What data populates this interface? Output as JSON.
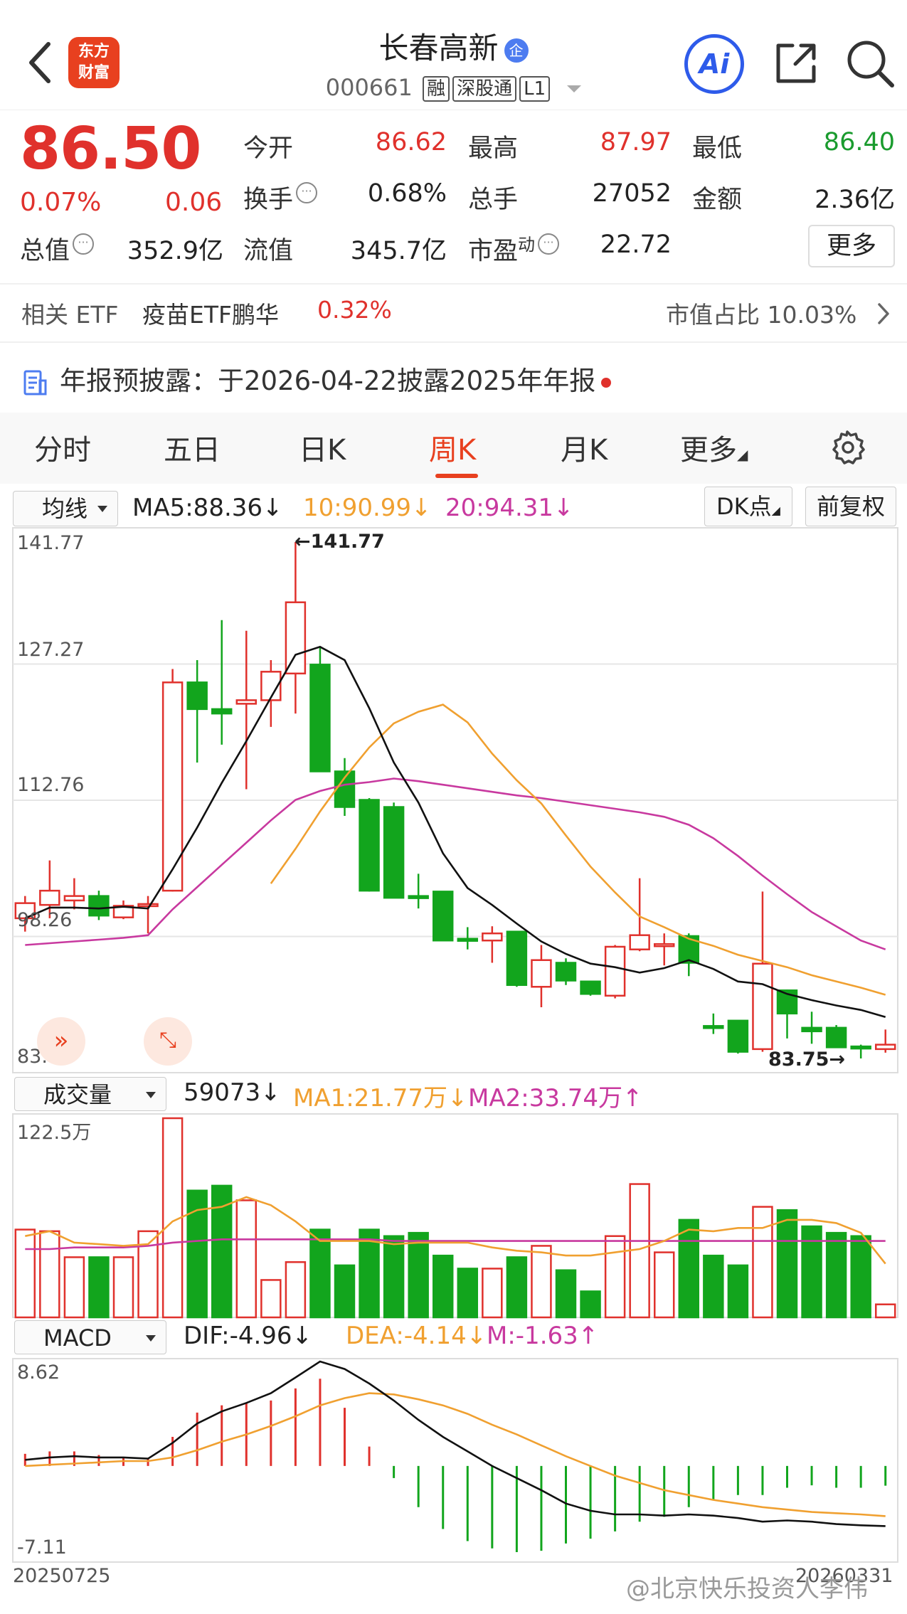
{
  "header": {
    "logo_text_1": "东方",
    "logo_text_2": "财富",
    "stock_name": "长春高新",
    "badge": "企",
    "code": "000661",
    "tags": [
      "融",
      "深股通",
      "L1"
    ]
  },
  "quote": {
    "price": "86.50",
    "change_pct": "0.07%",
    "change_abs": "0.06",
    "open_label": "今开",
    "open": "86.62",
    "high_label": "最高",
    "high": "87.97",
    "low_label": "最低",
    "low": "86.40",
    "turnover_label": "换手",
    "turnover": "0.68%",
    "volume_label": "总手",
    "volume": "27052",
    "amount_label": "金额",
    "amount": "2.36亿",
    "mcap_label": "总值",
    "mcap": "352.9亿",
    "float_label": "流值",
    "float": "345.7亿",
    "pe_label": "市盈",
    "pe_sup": "动",
    "pe": "22.72",
    "more": "更多"
  },
  "etf": {
    "label": "相关 ETF",
    "name": "疫苗ETF鹏华",
    "pct": "0.32%",
    "share_label": "市值占比",
    "share": "10.03%"
  },
  "notice": {
    "text": "年报预披露：于2026-04-22披露2025年年报"
  },
  "tabs": [
    "分时",
    "五日",
    "日K",
    "周K",
    "月K",
    "更多"
  ],
  "ma_row": {
    "select": "均线",
    "ma5": "MA5:88.36↓",
    "ma10": "10:90.99↓",
    "ma20": "20:94.31↓",
    "dk": "DK点",
    "fq": "前复权"
  },
  "vol_row": {
    "select": "成交量",
    "vol": "59073↓",
    "ma1": "MA1:21.77万↓",
    "ma2": "MA2:33.74万↑"
  },
  "macd_row": {
    "select": "MACD",
    "dif": "DIF:-4.96↓",
    "dea": "DEA:-4.14↓",
    "m": "M:-1.63↑"
  },
  "colors": {
    "up": "#e0312c",
    "down": "#12a51d",
    "ma5": "#111111",
    "ma10": "#f0a030",
    "ma20": "#c8399f"
  },
  "chart_data": {
    "type": "candlestick",
    "price_axis": {
      "max": 141.77,
      "min": 83.75,
      "ticks": [
        "141.77",
        "127.27",
        "112.76",
        "98.26",
        "83.75"
      ]
    },
    "high_marker": "←141.77",
    "low_marker": "83.75→",
    "volume_axis_max": "122.5万",
    "macd_axis": {
      "max": "8.62",
      "min": "-7.11"
    },
    "x_start": "20250725",
    "x_end": "20260331",
    "candles": [
      {
        "o": 99.5,
        "c": 101.2,
        "h": 102.0,
        "l": 98.0
      },
      {
        "o": 101.0,
        "c": 102.6,
        "h": 106.0,
        "l": 99.5
      },
      {
        "o": 101.5,
        "c": 102.0,
        "h": 104.0,
        "l": 100.5
      },
      {
        "o": 102.0,
        "c": 99.8,
        "h": 102.6,
        "l": 99.3
      },
      {
        "o": 99.6,
        "c": 100.9,
        "h": 101.5,
        "l": 99.4
      },
      {
        "o": 101.0,
        "c": 101.1,
        "h": 102.0,
        "l": 97.8
      },
      {
        "o": 102.6,
        "c": 126.0,
        "h": 127.5,
        "l": 102.5
      },
      {
        "o": 126.0,
        "c": 123.0,
        "h": 128.5,
        "l": 117.0
      },
      {
        "o": 123.0,
        "c": 122.5,
        "h": 133.0,
        "l": 119.0
      },
      {
        "o": 123.6,
        "c": 124.0,
        "h": 131.8,
        "l": 114.0
      },
      {
        "o": 124.0,
        "c": 127.2,
        "h": 128.5,
        "l": 121.0
      },
      {
        "o": 127.0,
        "c": 135.0,
        "h": 141.77,
        "l": 122.5
      },
      {
        "o": 128.0,
        "c": 116.0,
        "h": 130.0,
        "l": 116.0
      },
      {
        "o": 116.0,
        "c": 112.0,
        "h": 117.5,
        "l": 111.0
      },
      {
        "o": 112.8,
        "c": 102.6,
        "h": 113.0,
        "l": 102.5
      },
      {
        "o": 112.0,
        "c": 101.8,
        "h": 112.5,
        "l": 101.8
      },
      {
        "o": 102.0,
        "c": 101.8,
        "h": 104.5,
        "l": 100.6
      },
      {
        "o": 102.5,
        "c": 97.0,
        "h": 102.5,
        "l": 97.0
      },
      {
        "o": 97.2,
        "c": 97.0,
        "h": 98.5,
        "l": 96.0
      },
      {
        "o": 97.0,
        "c": 97.8,
        "h": 98.6,
        "l": 94.5
      },
      {
        "o": 98.0,
        "c": 92.0,
        "h": 98.0,
        "l": 91.8
      },
      {
        "o": 91.8,
        "c": 94.8,
        "h": 96.5,
        "l": 89.5
      },
      {
        "o": 94.5,
        "c": 92.5,
        "h": 95.0,
        "l": 92.0
      },
      {
        "o": 92.4,
        "c": 91.0,
        "h": 92.5,
        "l": 90.8
      },
      {
        "o": 90.8,
        "c": 96.3,
        "h": 96.5,
        "l": 90.5
      },
      {
        "o": 96.0,
        "c": 97.6,
        "h": 104.0,
        "l": 95.8
      },
      {
        "o": 96.6,
        "c": 96.6,
        "h": 97.8,
        "l": 94.2
      },
      {
        "o": 97.5,
        "c": 94.5,
        "h": 97.8,
        "l": 93.0
      },
      {
        "o": 87.4,
        "c": 87.2,
        "h": 88.8,
        "l": 86.5
      },
      {
        "o": 88.0,
        "c": 84.5,
        "h": 88.0,
        "l": 84.3
      },
      {
        "o": 84.8,
        "c": 94.4,
        "h": 102.5,
        "l": 84.5
      },
      {
        "o": 91.4,
        "c": 88.8,
        "h": 91.5,
        "l": 86.0
      },
      {
        "o": 87.2,
        "c": 86.8,
        "h": 89.0,
        "l": 85.4
      },
      {
        "o": 87.2,
        "c": 85.0,
        "h": 87.5,
        "l": 85.0
      },
      {
        "o": 85.1,
        "c": 84.9,
        "h": 85.3,
        "l": 83.75
      },
      {
        "o": 84.8,
        "c": 85.3,
        "h": 87.0,
        "l": 84.4
      }
    ],
    "ma5": [
      99.5,
      100.7,
      100.7,
      100.6,
      100.8,
      100.6,
      105.0,
      109.7,
      114.7,
      119.4,
      124.3,
      129.1,
      130.0,
      128.5,
      123.1,
      117.0,
      112.5,
      106.8,
      102.9,
      101.0,
      98.9,
      96.9,
      95.5,
      94.4,
      94.0,
      93.4,
      93.9,
      94.8,
      93.8,
      92.4,
      92.1,
      91.0,
      90.3,
      89.7,
      89.2,
      88.4
    ],
    "ma10": [
      null,
      null,
      null,
      null,
      null,
      null,
      null,
      null,
      null,
      null,
      103.4,
      107.3,
      111.5,
      115.3,
      118.7,
      121.4,
      122.7,
      123.5,
      121.5,
      118.0,
      115.0,
      112.4,
      108.8,
      105.3,
      102.4,
      99.7,
      98.5,
      97.2,
      96.4,
      95.4,
      94.7,
      94.0,
      93.1,
      92.4,
      91.7,
      90.9
    ],
    "ma20": [
      96.5,
      96.7,
      96.9,
      97.1,
      97.3,
      97.6,
      100.5,
      103.0,
      105.5,
      108.0,
      110.5,
      112.8,
      113.8,
      114.5,
      114.8,
      115.2,
      114.9,
      114.5,
      114.1,
      113.7,
      113.3,
      113.0,
      112.6,
      112.2,
      111.8,
      111.4,
      110.9,
      110.0,
      108.5,
      106.5,
      104.3,
      102.2,
      100.2,
      98.6,
      97.0,
      96.0
    ],
    "volume": [
      54,
      53,
      37,
      37,
      37,
      53,
      122.5,
      78,
      81,
      72,
      23,
      34,
      54,
      32,
      54,
      50,
      52,
      38,
      30,
      30,
      37,
      44,
      29,
      16,
      50,
      82,
      40,
      60,
      38,
      32,
      68,
      66,
      56,
      52,
      50,
      8
    ],
    "vol_ma1": [
      50,
      53,
      46,
      45,
      44,
      45,
      59,
      66,
      68,
      74,
      69,
      59,
      47,
      47,
      47,
      45,
      46,
      46,
      46,
      43,
      41,
      40,
      38,
      38,
      40,
      42,
      47,
      54,
      53,
      55,
      55,
      60,
      60,
      58,
      52,
      33
    ],
    "vol_ma2": [
      42,
      42,
      43,
      43,
      43,
      44,
      46,
      47,
      48,
      48,
      48,
      48,
      48,
      48,
      48,
      47,
      47,
      47,
      47,
      47,
      47,
      47,
      47,
      47,
      47,
      47,
      47,
      47,
      47,
      47,
      47,
      47,
      47,
      47,
      47,
      47
    ],
    "dif": [
      0.5,
      0.7,
      0.8,
      0.7,
      0.7,
      0.6,
      1.9,
      3.5,
      4.5,
      5.2,
      6.0,
      7.3,
      8.62,
      8.0,
      6.8,
      5.4,
      3.8,
      2.4,
      1.2,
      0.0,
      -1.0,
      -2.0,
      -3.1,
      -3.7,
      -4.0,
      -4.0,
      -4.1,
      -4.0,
      -4.1,
      -4.3,
      -4.6,
      -4.5,
      -4.6,
      -4.8,
      -4.9,
      -4.96
    ],
    "dea": [
      0.0,
      0.1,
      0.2,
      0.3,
      0.4,
      0.4,
      0.7,
      1.3,
      2.0,
      2.6,
      3.3,
      4.1,
      5.0,
      5.6,
      6.0,
      5.9,
      5.5,
      5.0,
      4.3,
      3.4,
      2.6,
      1.7,
      0.8,
      0.0,
      -0.8,
      -1.4,
      -2.0,
      -2.4,
      -2.8,
      -3.1,
      -3.4,
      -3.6,
      -3.8,
      -3.9,
      -4.0,
      -4.14
    ],
    "macd_m": [
      1.0,
      1.2,
      1.2,
      0.9,
      0.7,
      0.6,
      2.4,
      4.4,
      5.0,
      5.2,
      5.4,
      6.4,
      7.2,
      4.8,
      1.6,
      -1.0,
      -3.4,
      -5.2,
      -6.2,
      -6.8,
      -7.11,
      -7.0,
      -6.4,
      -6.0,
      -5.4,
      -4.6,
      -4.2,
      -3.4,
      -2.8,
      -2.4,
      -2.4,
      -1.8,
      -1.6,
      -1.8,
      -1.8,
      -1.63
    ]
  },
  "watermark": "@北京快乐投资人李伟"
}
